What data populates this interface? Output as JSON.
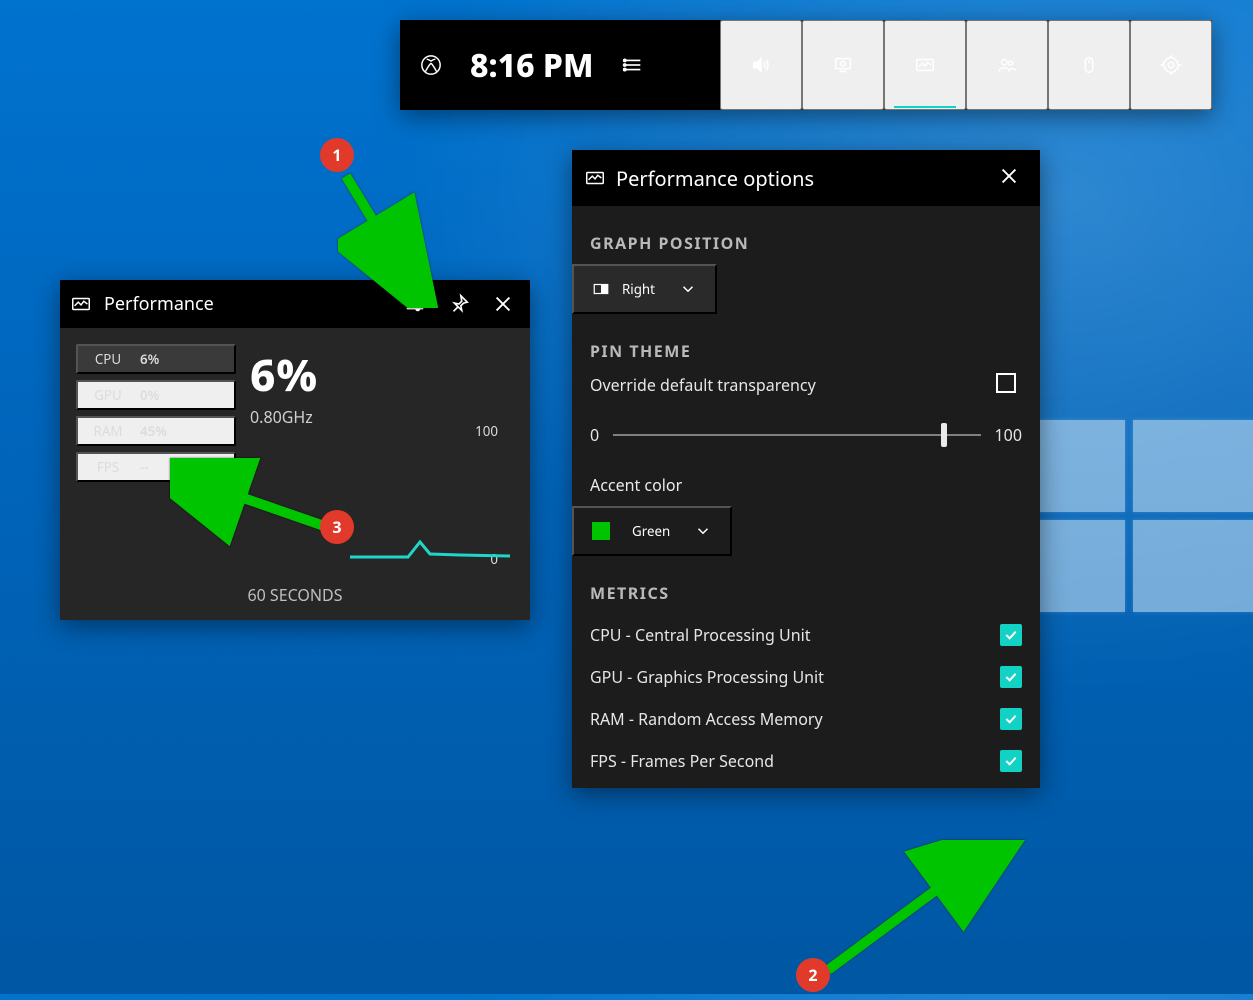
{
  "gamebar": {
    "time": "8:16 PM"
  },
  "performance": {
    "title": "Performance",
    "metrics": [
      {
        "label": "CPU",
        "value": "6%",
        "selected": true
      },
      {
        "label": "GPU",
        "value": "0%"
      },
      {
        "label": "RAM",
        "value": "45%"
      },
      {
        "label": "FPS",
        "value": "--"
      }
    ],
    "big_value": "6%",
    "big_sub": "0.80GHz",
    "chart": {
      "ymax": "100",
      "ymin": "0",
      "xlabel": "60 SECONDS"
    }
  },
  "options": {
    "title": "Performance options",
    "section_graph": "GRAPH POSITION",
    "graph_position": "Right",
    "section_pin": "PIN THEME",
    "override_label": "Override default transparency",
    "slider": {
      "min": "0",
      "max": "100",
      "value": 90
    },
    "accent_label": "Accent color",
    "accent_value": "Green",
    "accent_color": "#00c400",
    "section_metrics": "METRICS",
    "metrics": [
      {
        "label": "CPU - Central Processing Unit",
        "checked": true
      },
      {
        "label": "GPU - Graphics Processing Unit",
        "checked": true
      },
      {
        "label": "RAM - Random Access Memory",
        "checked": true
      },
      {
        "label": "FPS - Frames Per Second",
        "checked": true
      }
    ]
  },
  "annotations": {
    "c1": "1",
    "c2": "2",
    "c3": "3"
  }
}
